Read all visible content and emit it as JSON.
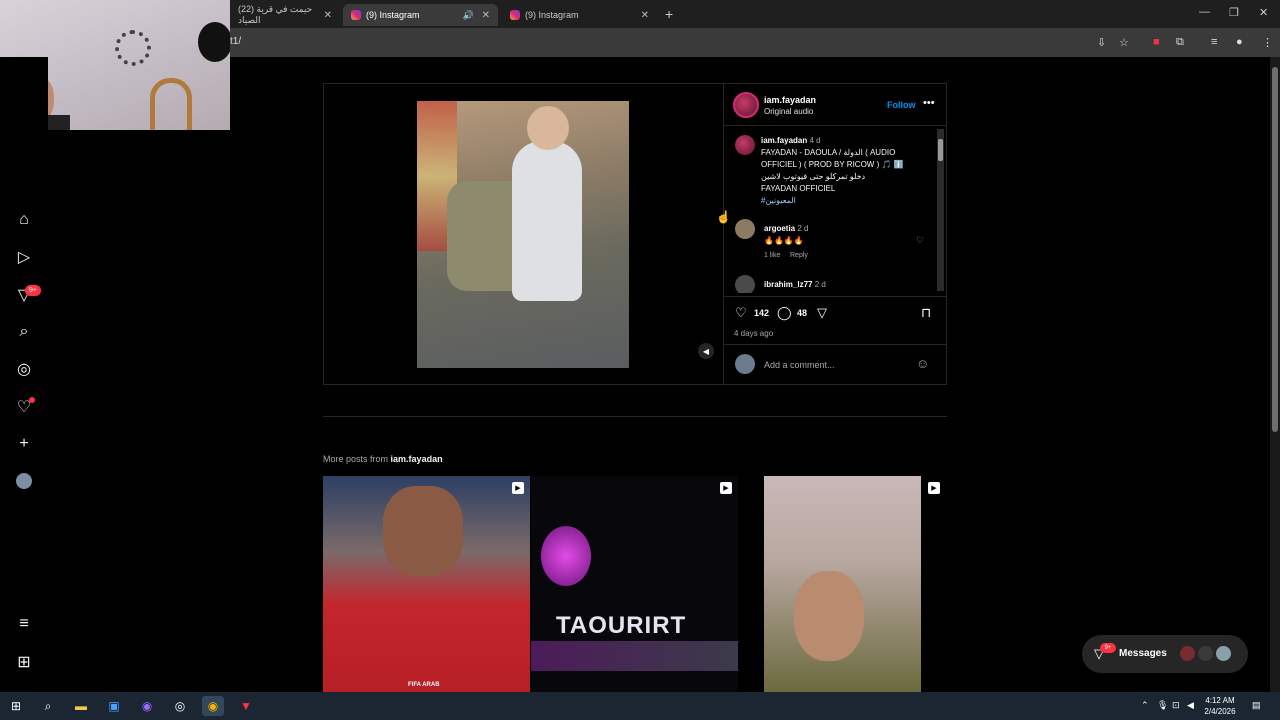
{
  "browser": {
    "tabs": [
      {
        "title": "(22) حيمت في قرية الصياد",
        "active": false
      },
      {
        "title": "(9) Instagram",
        "active": true
      },
      {
        "title": "(9) Instagram",
        "active": false
      }
    ],
    "url": "t1/",
    "new_tab": "+",
    "window": {
      "minimize": "—",
      "restore": "❐",
      "close": "✕"
    }
  },
  "sidebar": {
    "messages_badge": "9+"
  },
  "post": {
    "username": "iam.fayadan",
    "audio": "Original audio",
    "follow_label": "Follow",
    "more_icon": "•••",
    "caption": {
      "username": "iam.fayadan",
      "time": "4 d",
      "line1": "FAYADAN - DAOULA / الدولة ( AUDIO",
      "line2": "OFFICIEL ) ( PROD BY RICOW ) 🎵 ℹ️",
      "line3": "دخلو تمركلو حتى  فيوتوب لاشين",
      "line4": "FAYADAN OFFICIEL",
      "hashtag": "#المعبونين"
    },
    "comments": [
      {
        "username": "argoetia",
        "time": "2 d",
        "text": "🔥🔥🔥🔥",
        "likes": "1 like",
        "reply": "Reply"
      },
      {
        "username": "ibrahim_lz77",
        "time": "2 d",
        "text": "",
        "likes": "",
        "reply": ""
      }
    ],
    "like_count": "142",
    "comment_count": "48",
    "posted_ago": "4 days ago",
    "add_comment_placeholder": "Add a comment..."
  },
  "more_posts": {
    "label": "More posts from",
    "username": "iam.fayadan",
    "items": [
      {
        "caption": "FIFA ARAB"
      },
      {
        "caption": "TAOURIRT"
      },
      {
        "caption": ""
      }
    ]
  },
  "messages": {
    "label": "Messages",
    "badge": "9+"
  },
  "taskbar": {
    "time": "4:12 AM",
    "date": "2/4/2026"
  },
  "colors": {
    "accent": "#0095f6",
    "notification": "#ff3040",
    "background": "#000000",
    "border": "#262626"
  }
}
